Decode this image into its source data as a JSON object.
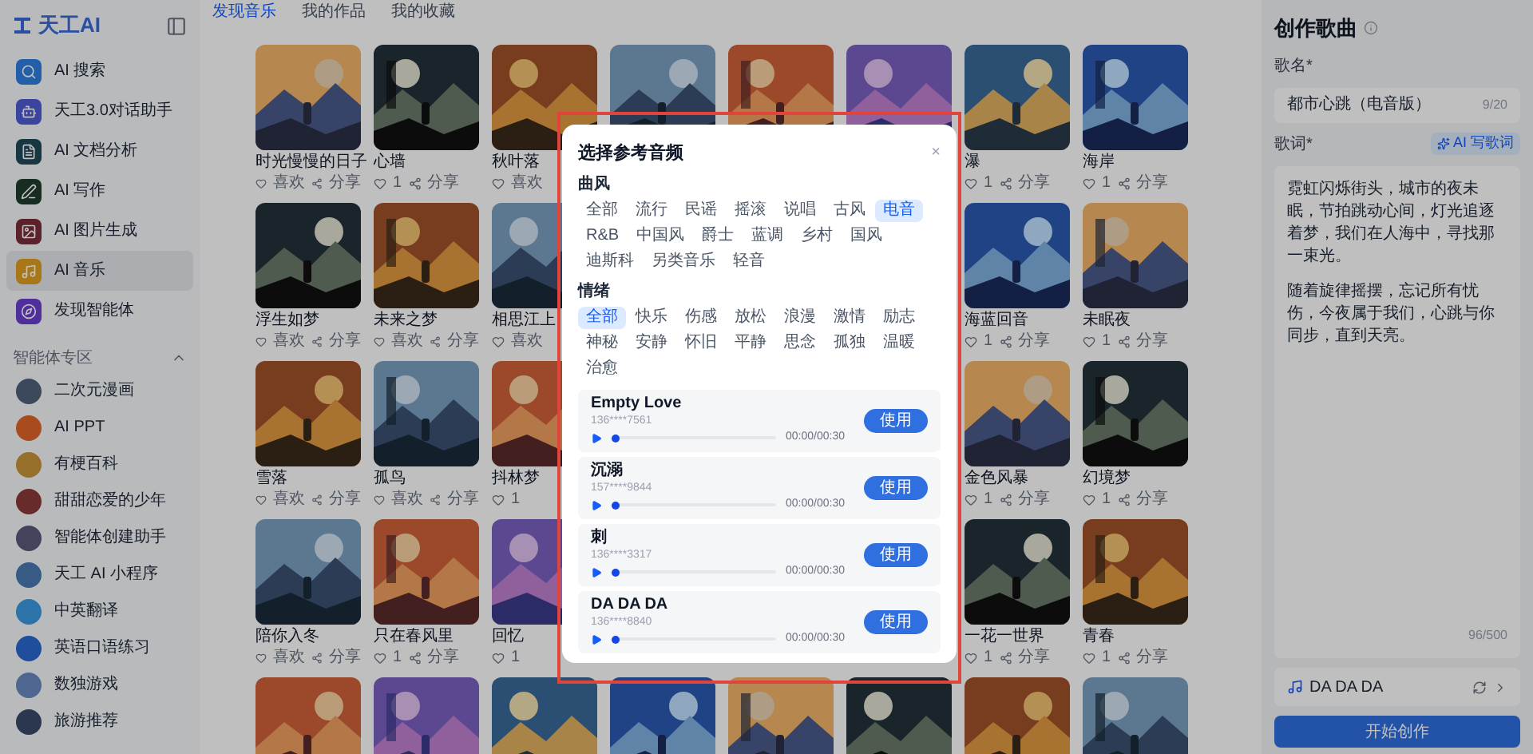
{
  "logo": {
    "text": "天工AI"
  },
  "sidebar": {
    "items": [
      {
        "label": "AI 搜索",
        "selected": false
      },
      {
        "label": "天工3.0对话助手",
        "selected": false
      },
      {
        "label": "AI 文档分析",
        "selected": false
      },
      {
        "label": "AI 写作",
        "selected": false
      },
      {
        "label": "AI 图片生成",
        "selected": false
      },
      {
        "label": "AI 音乐",
        "selected": true
      },
      {
        "label": "发现智能体",
        "selected": false
      }
    ],
    "section": {
      "title": "智能体专区",
      "expanded": true
    },
    "agents": [
      {
        "label": "二次元漫画"
      },
      {
        "label": "AI PPT"
      },
      {
        "label": "有梗百科"
      },
      {
        "label": "甜甜恋爱的少年"
      },
      {
        "label": "智能体创建助手"
      },
      {
        "label": "天工 AI 小程序"
      },
      {
        "label": "中英翻译"
      },
      {
        "label": "英语口语练习"
      },
      {
        "label": "数独游戏"
      },
      {
        "label": "旅游推荐"
      }
    ]
  },
  "tabs": [
    {
      "label": "发现音乐",
      "selected": true
    },
    {
      "label": "我的作品",
      "selected": false
    },
    {
      "label": "我的收藏",
      "selected": false
    }
  ],
  "grid": {
    "rows": [
      [
        {
          "kind": "picture",
          "caption": "时光慢慢的日子",
          "likes": "喜欢",
          "share": "分享"
        },
        {
          "kind": "picture",
          "caption": "心墙",
          "likes": "1",
          "share": "分享"
        },
        {
          "kind": "picture",
          "caption": "秋叶落",
          "likes": "喜欢"
        },
        {
          "kind": "picture"
        },
        {
          "kind": "picture"
        },
        {
          "kind": "picture"
        },
        {
          "kind": "picture",
          "caption": "瀑",
          "likes": "1",
          "share": "分享"
        },
        {
          "kind": "picture",
          "caption": "海岸",
          "likes": "1",
          "share": "分享"
        }
      ],
      [
        {
          "kind": "picture",
          "caption": "浮生如梦",
          "likes": "喜欢",
          "share": "分享"
        },
        {
          "kind": "picture",
          "caption": "未来之梦",
          "likes": "喜欢",
          "share": "分享"
        },
        {
          "kind": "picture",
          "caption": "相思江上",
          "likes": "喜欢"
        },
        {
          "kind": "covered"
        },
        {
          "kind": "covered"
        },
        {
          "kind": "covered"
        },
        {
          "kind": "picture",
          "caption": "海蓝回音",
          "likes": "1",
          "share": "分享"
        },
        {
          "kind": "picture",
          "caption": "未眠夜",
          "likes": "1",
          "share": "分享"
        }
      ],
      [
        {
          "kind": "picture",
          "caption": "雪落",
          "likes": "喜欢",
          "share": "分享"
        },
        {
          "kind": "picture",
          "caption": "孤鸟",
          "likes": "喜欢",
          "share": "分享"
        },
        {
          "kind": "picture",
          "caption": "抖林梦",
          "likes": "1"
        },
        {
          "kind": "covered"
        },
        {
          "kind": "covered"
        },
        {
          "kind": "covered"
        },
        {
          "kind": "picture",
          "caption": "金色风暴",
          "likes": "1",
          "share": "分享"
        },
        {
          "kind": "picture",
          "caption": "幻境梦",
          "likes": "1",
          "share": "分享"
        }
      ],
      [
        {
          "kind": "picture",
          "caption": "陪你入冬",
          "likes": "喜欢",
          "share": "分享"
        },
        {
          "kind": "picture",
          "caption": "只在春风里",
          "likes": "1",
          "share": "分享"
        },
        {
          "kind": "picture",
          "caption": "回忆",
          "likes": "1"
        },
        {
          "kind": "covered"
        },
        {
          "kind": "covered"
        },
        {
          "kind": "covered"
        },
        {
          "kind": "picture",
          "caption": "一花一世界",
          "likes": "1",
          "share": "分享"
        },
        {
          "kind": "picture",
          "caption": "青春",
          "likes": "1",
          "share": "分享"
        }
      ],
      [
        {
          "kind": "picture"
        },
        {
          "kind": "picture"
        },
        {
          "kind": "picture"
        },
        {
          "kind": "picture"
        },
        {
          "kind": "picture"
        },
        {
          "kind": "picture"
        },
        {
          "kind": "picture"
        },
        {
          "kind": "picture"
        }
      ]
    ]
  },
  "modal": {
    "title": "选择参考音频",
    "close": "×",
    "genre": {
      "label": "曲风",
      "tags": [
        {
          "label": "全部",
          "selected": false
        },
        {
          "label": "流行",
          "selected": false
        },
        {
          "label": "民谣",
          "selected": false
        },
        {
          "label": "摇滚",
          "selected": false
        },
        {
          "label": "说唱",
          "selected": false
        },
        {
          "label": "古风",
          "selected": false
        },
        {
          "label": "电音",
          "selected": true
        },
        {
          "label": "R&B",
          "selected": false
        },
        {
          "label": "中国风",
          "selected": false
        },
        {
          "label": "爵士",
          "selected": false
        },
        {
          "label": "蓝调",
          "selected": false
        },
        {
          "label": "乡村",
          "selected": false
        },
        {
          "label": "国风",
          "selected": false
        },
        {
          "label": "迪斯科",
          "selected": false
        },
        {
          "label": "另类音乐",
          "selected": false
        },
        {
          "label": "轻音",
          "selected": false
        }
      ]
    },
    "mood": {
      "label": "情绪",
      "tags": [
        {
          "label": "全部",
          "selected": true
        },
        {
          "label": "快乐",
          "selected": false
        },
        {
          "label": "伤感",
          "selected": false
        },
        {
          "label": "放松",
          "selected": false
        },
        {
          "label": "浪漫",
          "selected": false
        },
        {
          "label": "激情",
          "selected": false
        },
        {
          "label": "励志",
          "selected": false
        },
        {
          "label": "神秘",
          "selected": false
        },
        {
          "label": "安静",
          "selected": false
        },
        {
          "label": "怀旧",
          "selected": false
        },
        {
          "label": "平静",
          "selected": false
        },
        {
          "label": "思念",
          "selected": false
        },
        {
          "label": "孤独",
          "selected": false
        },
        {
          "label": "温暖",
          "selected": false
        },
        {
          "label": "治愈",
          "selected": false
        }
      ]
    },
    "tracks": [
      {
        "name": "Empty Love",
        "user": "136****7561",
        "time": "00:00/00:30",
        "level": 0,
        "button": "使用"
      },
      {
        "name": "沉溺",
        "user": "157****9844",
        "time": "00:00/00:30",
        "level": 0,
        "button": "使用"
      },
      {
        "name": "刺",
        "user": "136****3317",
        "time": "00:00/00:30",
        "level": 0,
        "button": "使用"
      },
      {
        "name": "DA DA DA",
        "user": "136****8840",
        "time": "00:00/00:30",
        "level": 0,
        "button": "使用"
      }
    ]
  },
  "panel": {
    "title": "创作歌曲",
    "name_label": "歌名*",
    "name_value": "都市心跳（电音版）",
    "name_count": "9/20",
    "lyrics_label": "歌词*",
    "ai_button": "AI 写歌词",
    "lyrics": [
      "霓虹闪烁街头，城市的夜未眠，节拍跳动心间，灯光追逐着梦，我们在人海中，寻找那一束光。",
      "随着旋律摇摆，忘记所有忧伤，今夜属于我们，心跳与你同步，直到天亮。"
    ],
    "lyrics_count": "96/500",
    "reference": "DA DA DA",
    "submit": "开始创作"
  }
}
